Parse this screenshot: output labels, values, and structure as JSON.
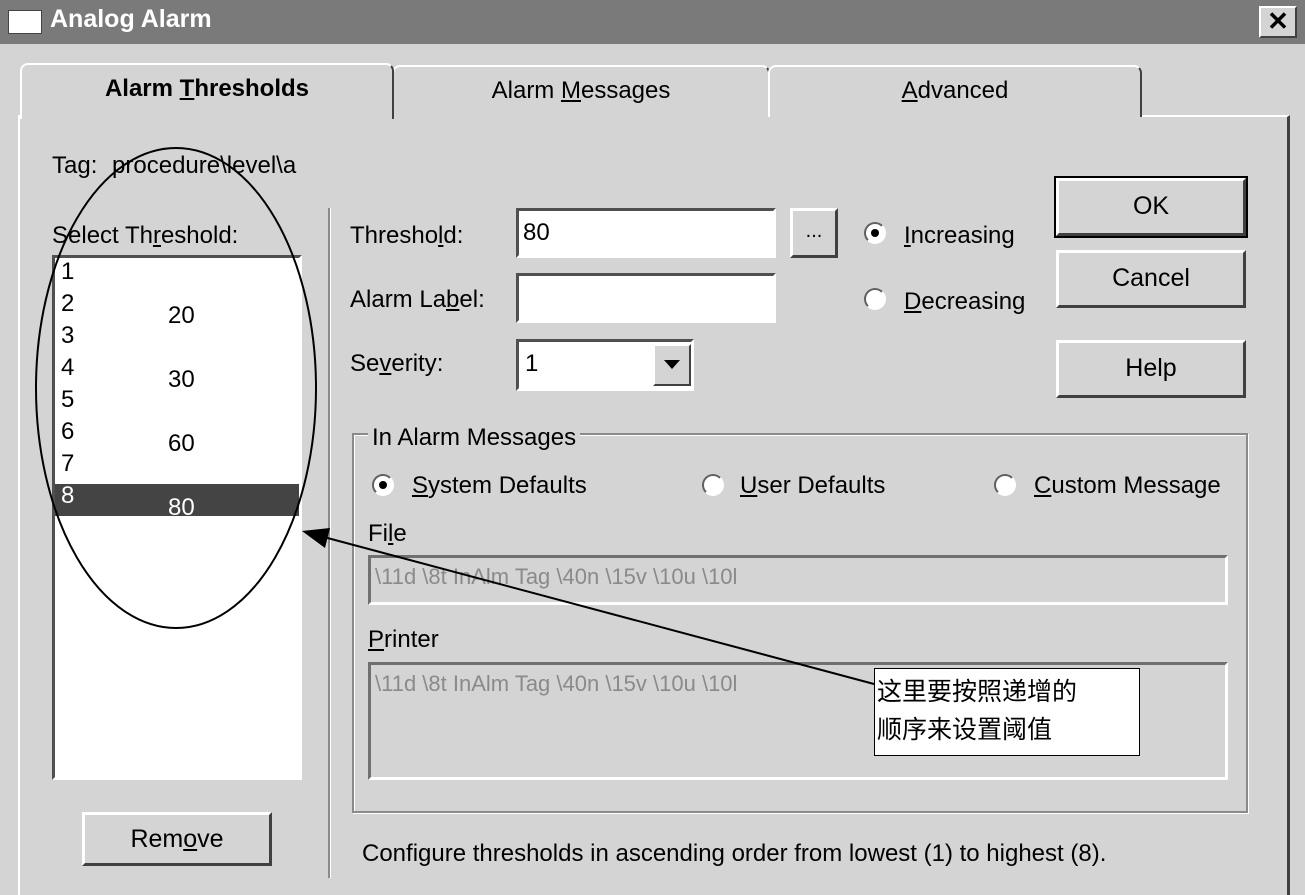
{
  "window": {
    "title": "Analog Alarm",
    "close_glyph": "✕"
  },
  "tabs": [
    {
      "label_pre": "Alarm ",
      "label_u": "T",
      "label_post": "hresholds",
      "active": true
    },
    {
      "label_pre": "Alarm ",
      "label_u": "M",
      "label_post": "essages",
      "active": false
    },
    {
      "label_pre": "",
      "label_u": "A",
      "label_post": "dvanced",
      "active": false
    }
  ],
  "tag": {
    "label": "Tag:",
    "value": "procedure\\level\\a"
  },
  "select_threshold": {
    "pre": "Select Th",
    "u": "r",
    "post": "eshold:"
  },
  "thresholds": [
    {
      "n": "1",
      "v": ""
    },
    {
      "n": "2",
      "v": "20"
    },
    {
      "n": "3",
      "v": ""
    },
    {
      "n": "4",
      "v": "30"
    },
    {
      "n": "5",
      "v": ""
    },
    {
      "n": "6",
      "v": "60"
    },
    {
      "n": "7",
      "v": ""
    },
    {
      "n": "8",
      "v": "80"
    }
  ],
  "selected_threshold": "8",
  "threshold": {
    "pre": "Thresho",
    "u": "l",
    "post": "d:",
    "value": "80",
    "browse": "..."
  },
  "alarm_label": {
    "pre": "Alarm La",
    "u": "b",
    "post": "el:",
    "value": ""
  },
  "severity": {
    "pre": "Se",
    "u": "v",
    "post": "erity:",
    "value": "1"
  },
  "direction": {
    "increasing": {
      "u": "I",
      "post": "ncreasing",
      "checked": true
    },
    "decreasing": {
      "u": "D",
      "post": "ecreasing",
      "checked": false
    }
  },
  "buttons": {
    "ok": "OK",
    "cancel": "Cancel",
    "help": "Help",
    "remove_pre": "Rem",
    "remove_u": "o",
    "remove_post": "ve"
  },
  "in_alarm": {
    "legend": "In Alarm Messages",
    "system": {
      "u": "S",
      "post": "ystem Defaults",
      "checked": true
    },
    "user": {
      "u": "U",
      "post": "ser Defaults",
      "checked": false
    },
    "custom": {
      "u": "C",
      "post": "ustom Message",
      "checked": false
    },
    "file_pre": "Fi",
    "file_u": "l",
    "file_post": "e",
    "file_value": "\\11d \\8t InAlm Tag \\40n \\15v \\10u \\10l",
    "printer_u": "P",
    "printer_post": "rinter",
    "printer_value": "\\11d \\8t InAlm Tag \\40n \\15v \\10u \\10l"
  },
  "footer": "Configure thresholds in ascending order from lowest (1) to highest (8).",
  "callout": {
    "line1": "这里要按照递增的",
    "line2": "顺序来设置阈值"
  }
}
